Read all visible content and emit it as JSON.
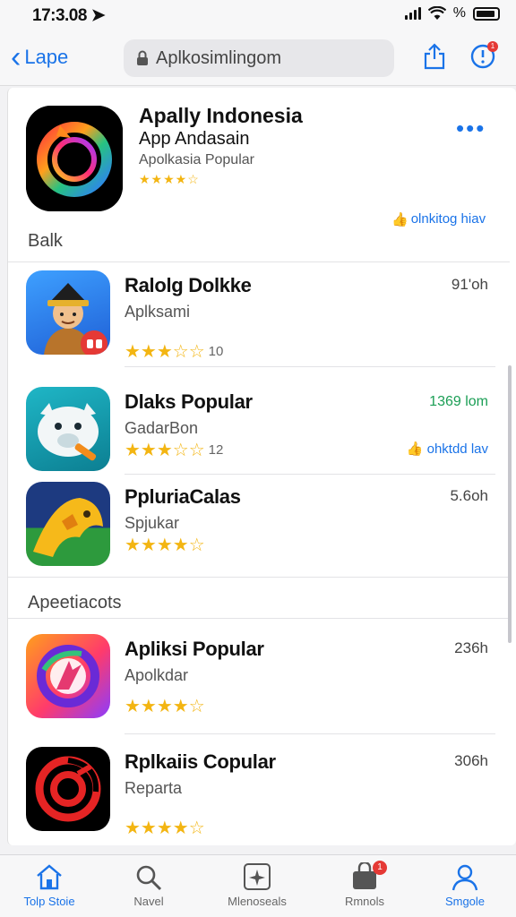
{
  "status_bar": {
    "time": "17:3.08",
    "battery_label": "%"
  },
  "nav": {
    "back_label": "Lape",
    "url": "Aplkosimlingom"
  },
  "notif_badge": "1",
  "featured": {
    "title": "Apally Indonesia",
    "subtitle": "App Andasain",
    "caption": "Apolkasia Popular",
    "stars": "★★★★☆",
    "more": "•••",
    "link": "olnkitog hiav"
  },
  "sections": [
    {
      "label": "Balk"
    },
    {
      "label": "Apeetiacots"
    }
  ],
  "apps": [
    {
      "name": "Ralolg Dolkke",
      "sub": "Aplksami",
      "stars": "★★★☆☆",
      "count": "10",
      "time": "91'oh",
      "tag": "",
      "link": ""
    },
    {
      "name": "Dlaks Popular",
      "sub": "GadarBon",
      "stars": "★★★☆☆",
      "count": "12",
      "time": "",
      "tag": "1369 lom",
      "link": "ohktdd lav"
    },
    {
      "name": "PpluriaCalas",
      "sub": "Spjukar",
      "stars": "★★★★☆",
      "count": "",
      "time": "5.6oh",
      "tag": "",
      "link": ""
    },
    {
      "name": "Apliksi Popular",
      "sub": "Apolkdar",
      "stars": "★★★★☆",
      "count": "",
      "time": "236h",
      "tag": "",
      "link": ""
    },
    {
      "name": "Rplkaiis Copular",
      "sub": "Reparta",
      "stars": "★★★★☆",
      "count": "",
      "time": "306h",
      "tag": "",
      "link": ""
    }
  ],
  "tabs": [
    {
      "label": "Tolp Stoie",
      "icon": "home-icon"
    },
    {
      "label": "Navel",
      "icon": "search-icon"
    },
    {
      "label": "Mlenoseals",
      "icon": "sparkle-icon"
    },
    {
      "label": "Rmnols",
      "icon": "bag-icon",
      "badge": "1"
    },
    {
      "label": "Smgole",
      "icon": "person-icon"
    }
  ]
}
